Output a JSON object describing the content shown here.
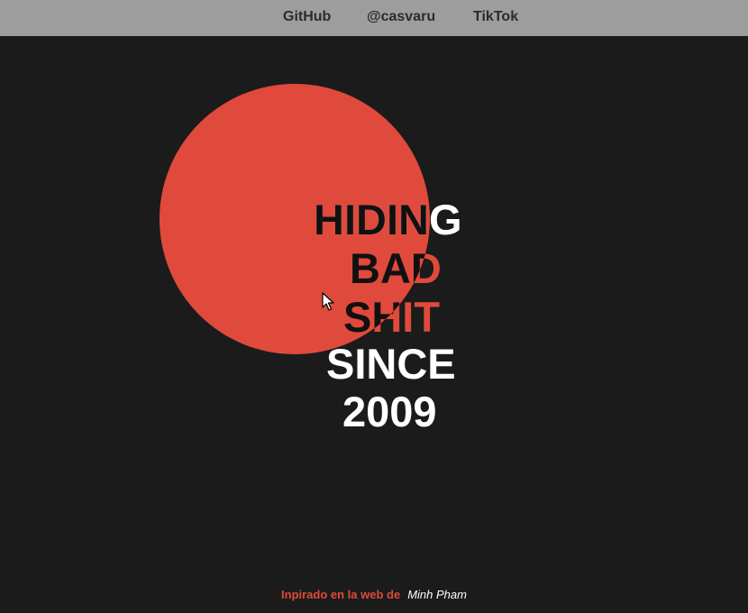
{
  "nav": {
    "links": [
      {
        "label": "GitHub"
      },
      {
        "label": "@casvaru"
      },
      {
        "label": "TikTok"
      }
    ]
  },
  "hero": {
    "lines": [
      "HIDING",
      "BAD",
      "SHIT",
      "SINCE",
      "2009"
    ],
    "circle_color": "#e04a3c",
    "text_color": "#ffffff",
    "masked_text_color": "#111111"
  },
  "footer": {
    "text": "Inpirado en la web de",
    "link_label": "Minh Pham"
  },
  "colors": {
    "background": "#1b1b1b",
    "topbar": "#9d9d9d",
    "accent": "#e04a3c"
  },
  "icons": {
    "cursor": "mouse-pointer-icon"
  }
}
